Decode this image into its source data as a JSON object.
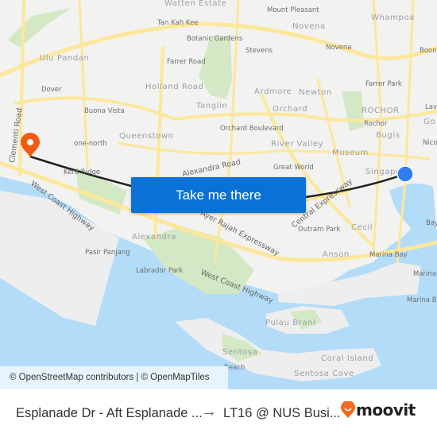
{
  "map": {
    "labels": [
      "Watten Estate",
      "Mount Pleasant",
      "Whampoa",
      "Tan Kah Kee",
      "Novena",
      "Botanic Gardens",
      "Novena",
      "Ulu Pandan",
      "Stevens",
      "Farrer Road",
      "Boon",
      "Farrer Park",
      "Dover",
      "Holland Road",
      "Ardmore",
      "Newton",
      "Tanglin",
      "Orchard",
      "ROCHOR",
      "Buona Vista",
      "Lav",
      "Rochor",
      "Go",
      "Orchard Boulevard",
      "Queenstown",
      "Bugis",
      "Nico",
      "one-north",
      "River Valley",
      "Museum",
      "Kent Ridge",
      "Great World",
      "Singapore",
      "Bayfront",
      "Outram Park",
      "Cecil",
      "Alexandra",
      "Pasir Panjang",
      "Anson",
      "Marina Bay",
      "Labrador Park",
      "Marina",
      "Marina Bay Cruise Centre",
      "Pulau Brani",
      "Sentosa",
      "Coral Island",
      "Beach",
      "Sentosa Cove"
    ],
    "road_labels": [
      "Clementi Road",
      "West Coast Highway",
      "Alexandra Road",
      "Ayer Rajah Expressway",
      "Central Expressway",
      "West Coast Highway"
    ],
    "colors": {
      "land": "#f2f2f0",
      "water": "#b3dcf9",
      "road": "#fde79a",
      "park": "#d3e8c4",
      "route": "#222222",
      "origin": "#2f7ef0",
      "destination": "#f25a11",
      "button": "#0a72d4"
    },
    "origin_icon": "blue-dot-icon",
    "destination_icon": "map-pin-icon"
  },
  "cta": {
    "label": "Take me there"
  },
  "attribution": "© OpenStreetMap contributors | © OpenMapTiles",
  "footer": {
    "from": "Esplanade Dr - Aft Esplanade ...",
    "arrow": "→",
    "to": "LT16 @ NUS Busi...",
    "brand": "moovit"
  }
}
